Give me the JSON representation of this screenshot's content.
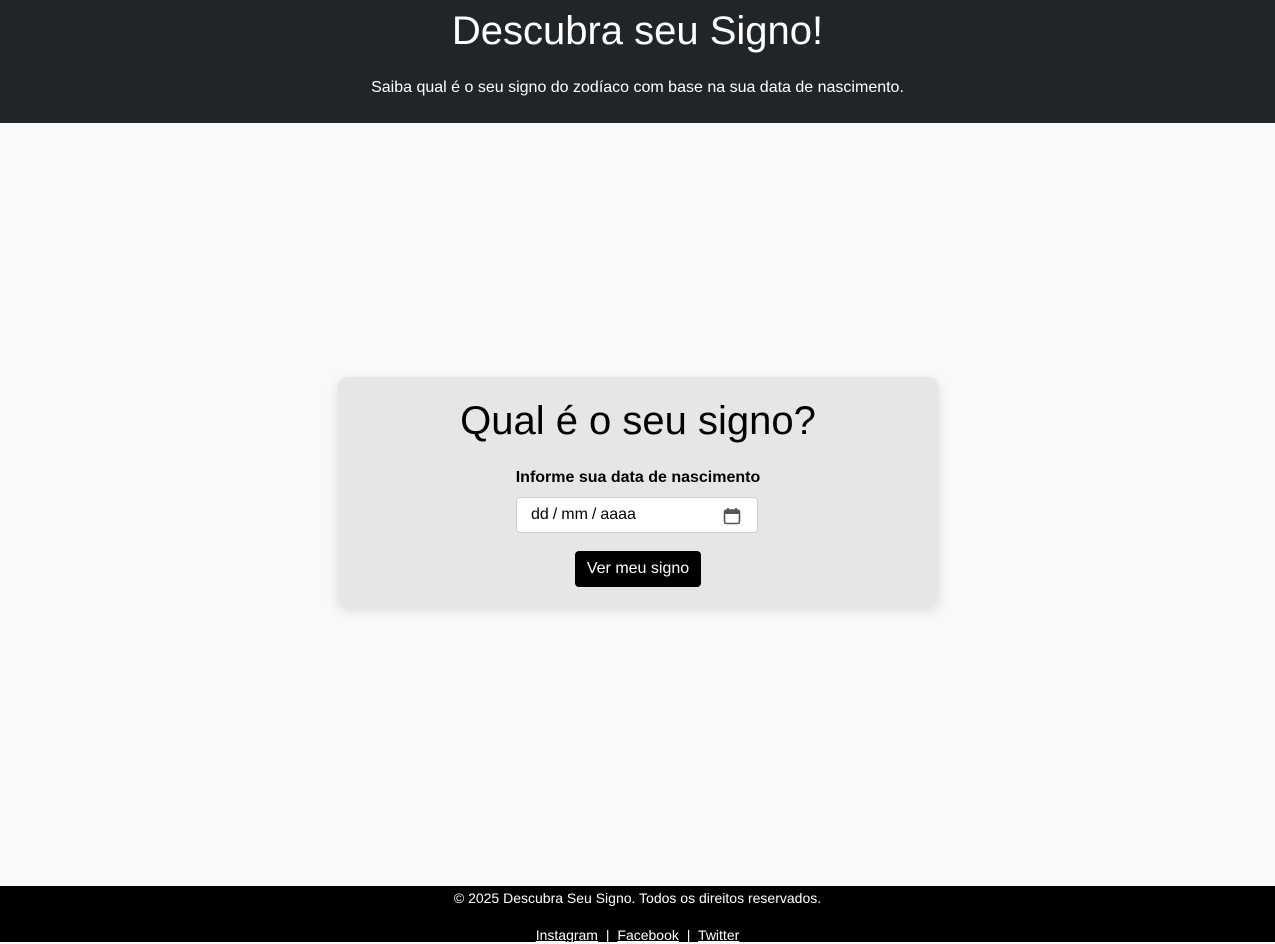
{
  "header": {
    "title": "Descubra seu Signo!",
    "subtitle": "Saiba qual é o seu signo do zodíaco com base na sua data de nascimento."
  },
  "form": {
    "title": "Qual é o seu signo?",
    "label": "Informe sua data de nascimento",
    "date_placeholder": {
      "day": "dd",
      "month": "mm",
      "year": "aaaa",
      "separator": "/"
    },
    "calendar_icon": "calendar-icon",
    "submit_label": "Ver meu signo"
  },
  "footer": {
    "copyright": "© 2025 Descubra Seu Signo. Todos os direitos reservados.",
    "separator": "|",
    "links": [
      {
        "label": "Instagram"
      },
      {
        "label": "Facebook"
      },
      {
        "label": "Twitter"
      }
    ]
  },
  "colors": {
    "header_bg": "#212529",
    "page_bg": "#f8f9fa",
    "card_bg": "#e6e6e6",
    "button_bg": "#000000",
    "footer_bg": "#000000"
  }
}
